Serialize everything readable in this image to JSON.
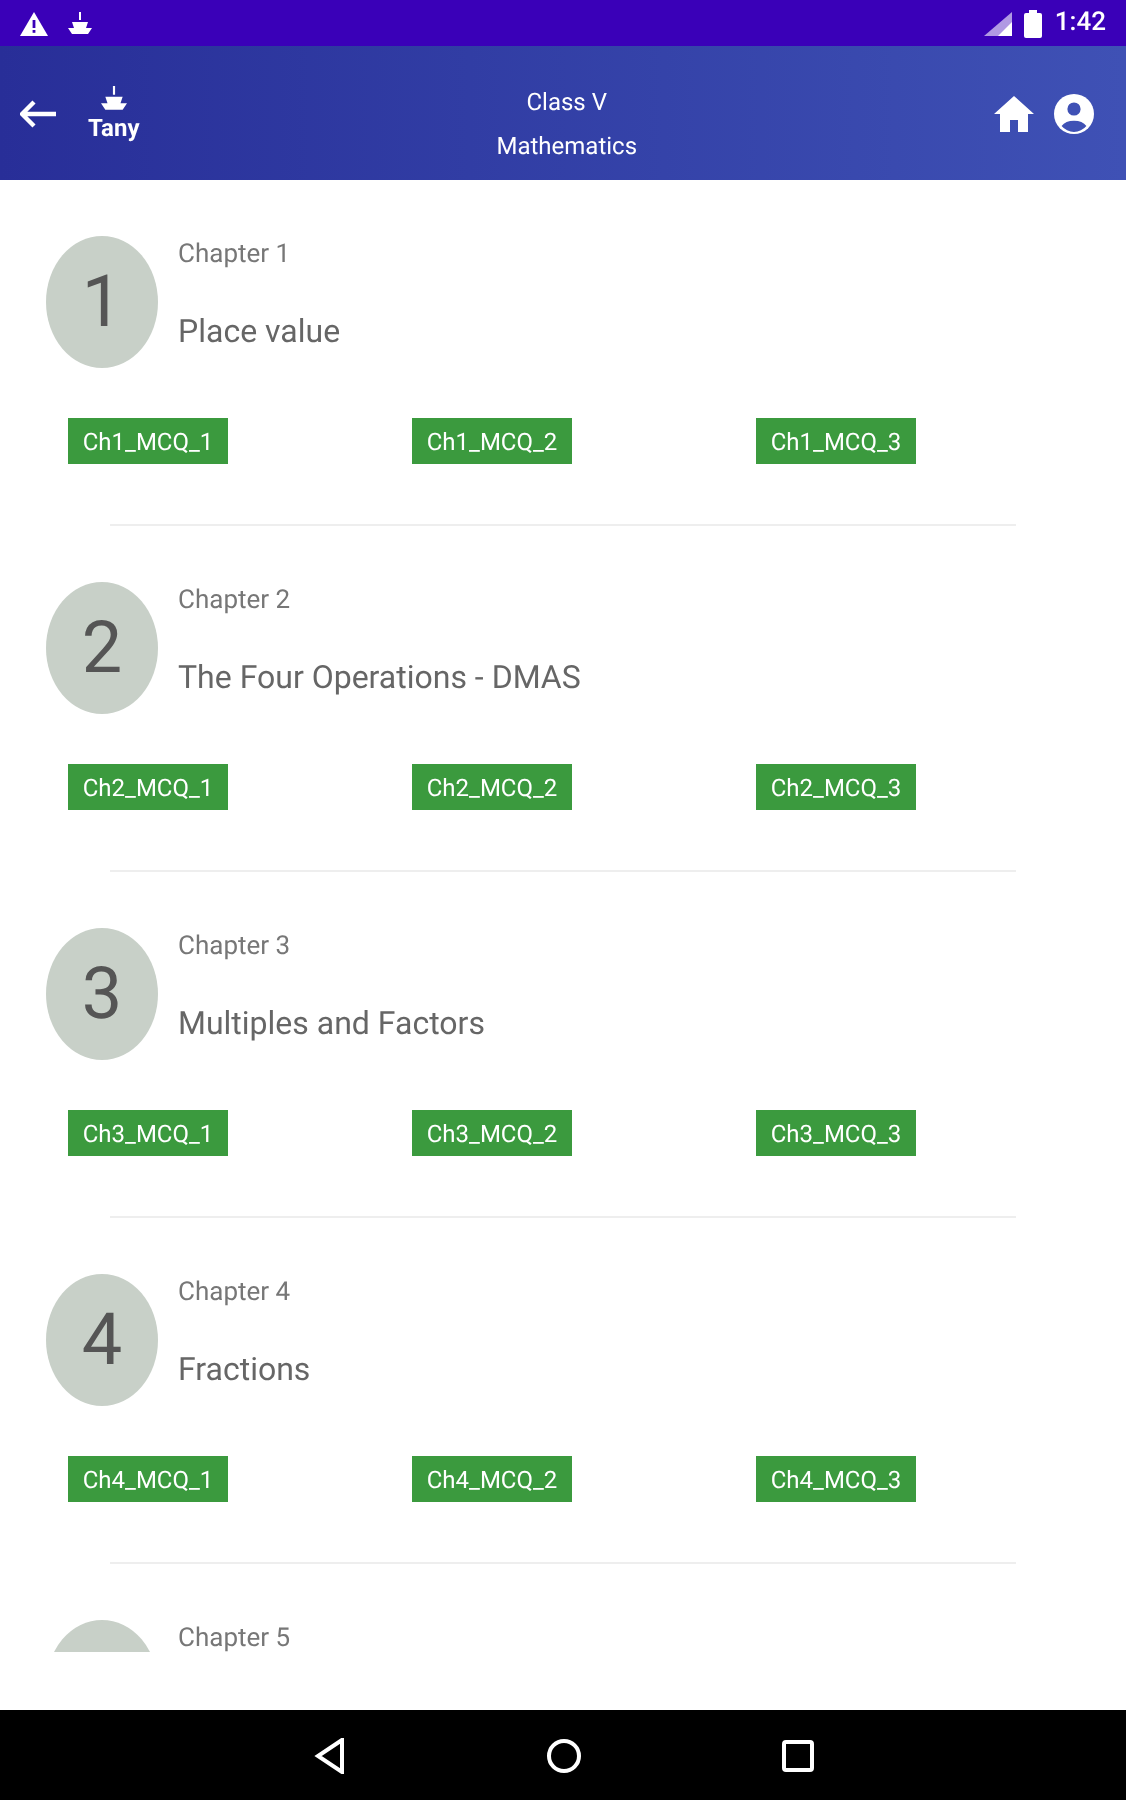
{
  "status_bar": {
    "time": "1:42"
  },
  "app_bar": {
    "user": "Tany",
    "title": "Class V",
    "subtitle": "Mathematics"
  },
  "chapters": [
    {
      "number": "1",
      "label": "Chapter 1",
      "title": "Place value",
      "quizzes": [
        "Ch1_MCQ_1",
        "Ch1_MCQ_2",
        "Ch1_MCQ_3"
      ]
    },
    {
      "number": "2",
      "label": "Chapter 2",
      "title": "The Four Operations - DMAS",
      "quizzes": [
        "Ch2_MCQ_1",
        "Ch2_MCQ_2",
        "Ch2_MCQ_3"
      ]
    },
    {
      "number": "3",
      "label": "Chapter 3",
      "title": "Multiples and Factors",
      "quizzes": [
        "Ch3_MCQ_1",
        "Ch3_MCQ_2",
        "Ch3_MCQ_3"
      ]
    },
    {
      "number": "4",
      "label": "Chapter 4",
      "title": "Fractions",
      "quizzes": [
        "Ch4_MCQ_1",
        "Ch4_MCQ_2",
        "Ch4_MCQ_3"
      ]
    },
    {
      "label": "Chapter 5"
    }
  ]
}
